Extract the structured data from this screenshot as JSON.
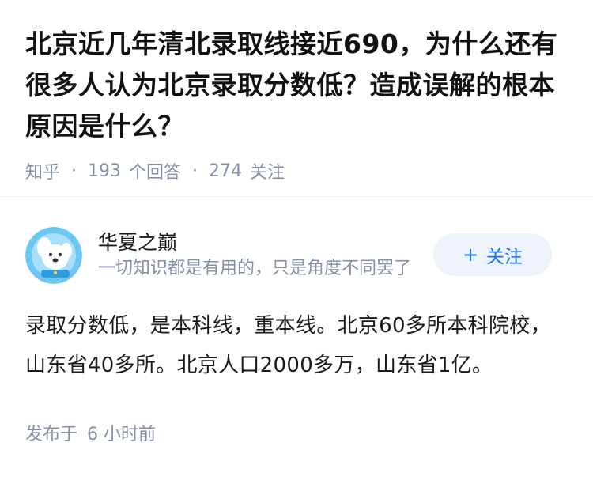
{
  "question": {
    "title": "北京近几年清北录取线接近690，为什么还有很多人认为北京录取分数低？造成误解的根本原因是什么？",
    "source": "知乎",
    "answer_count": "193",
    "answer_label": "个回答",
    "follower_count": "274",
    "follower_label": "关注"
  },
  "answer": {
    "author_name": "华夏之巅",
    "author_bio": "一切知识都是有用的，只是角度不同罢了",
    "follow_label": "关注",
    "content": "录取分数低，是本科线，重本线。北京60多所本科院校，山东省40多所。北京人口2000多万，山东省1亿。",
    "time_label": "发布于",
    "time_value": "6 小时前"
  },
  "colors": {
    "accent": "#1772f6",
    "meta": "#8590a6",
    "follow_bg": "#eef3fb"
  }
}
